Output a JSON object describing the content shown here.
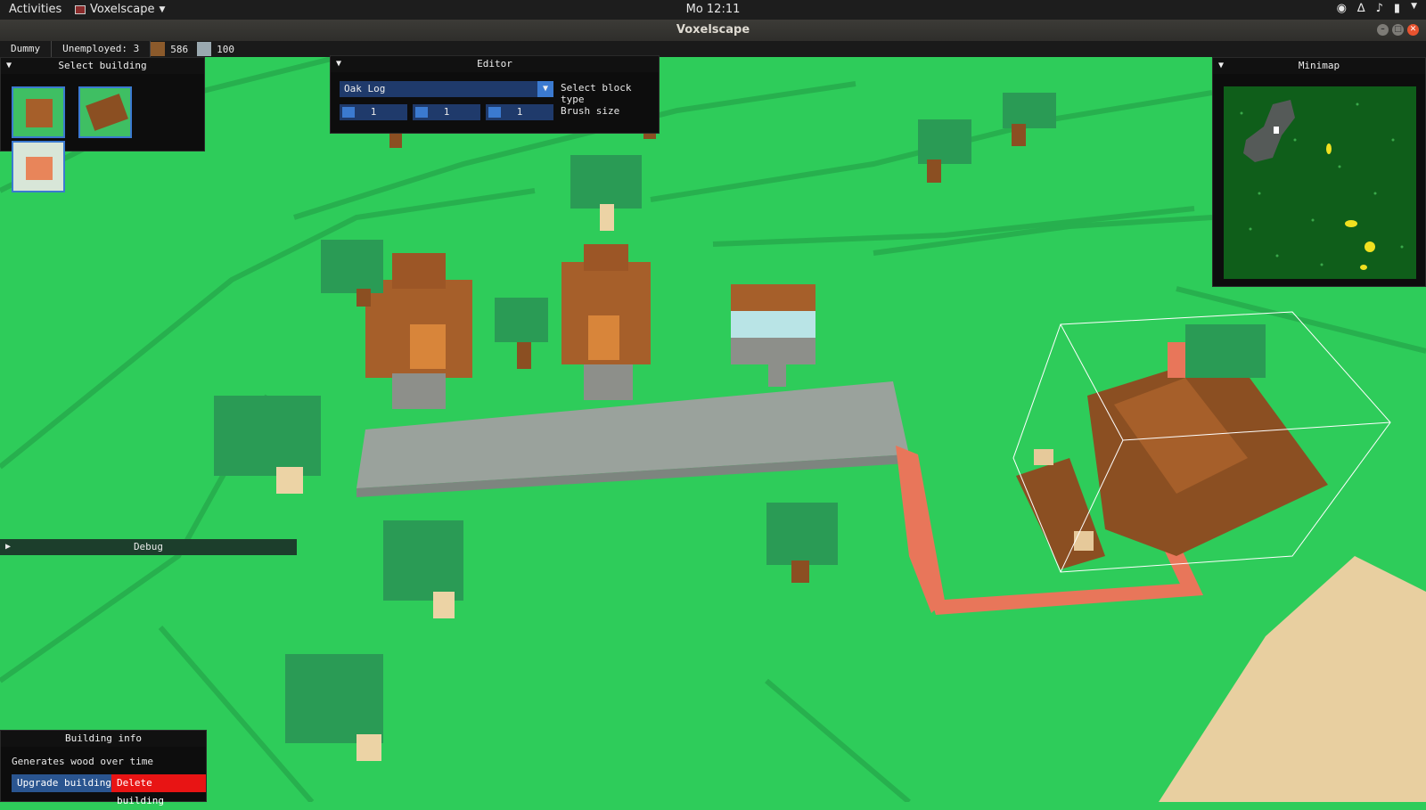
{
  "topbar": {
    "activities": "Activities",
    "app_name": "Voxelscape",
    "clock": "Mo 12:11",
    "tray_icons": [
      "discord-icon",
      "wifi-icon",
      "volume-icon",
      "battery-icon",
      "chevron-down-icon"
    ]
  },
  "window": {
    "title": "Voxelscape"
  },
  "status": {
    "player": "Dummy",
    "unemployed": "Unemployed: 3",
    "wood_color": "#8b5a2b",
    "wood": "586",
    "stone_color": "#9aa9b0",
    "stone": "100"
  },
  "select_building": {
    "title": "Select building",
    "items": [
      "house-thumbnail",
      "lumber-thumbnail",
      "farm-thumbnail"
    ]
  },
  "editor": {
    "title": "Editor",
    "block_type": "Oak Log",
    "block_type_label": "Select block type",
    "brush": [
      "1",
      "1",
      "1"
    ],
    "brush_label": "Brush size"
  },
  "minimap": {
    "title": "Minimap"
  },
  "debug": {
    "title": "Debug"
  },
  "building_info": {
    "title": "Building info",
    "description": "Generates wood over time",
    "upgrade_label": "Upgrade building",
    "delete_label": "Delete building"
  },
  "colors": {
    "grass": "#2ecc5a",
    "accent": "#3b7ad0",
    "delete": "#e81414"
  }
}
